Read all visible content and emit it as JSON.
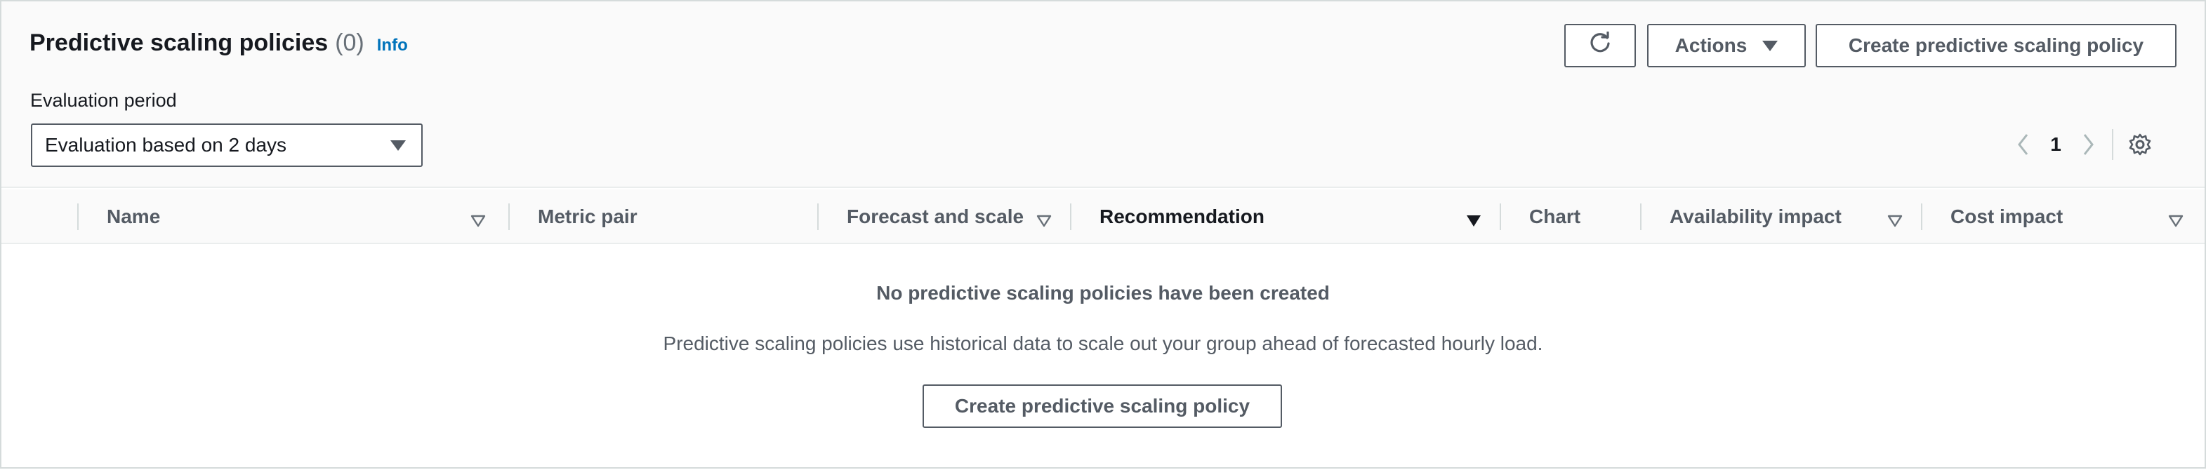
{
  "header": {
    "title": "Predictive scaling policies",
    "count": "(0)",
    "info_link": "Info",
    "refresh_icon": "refresh-icon",
    "actions_label": "Actions",
    "create_label": "Create predictive scaling policy"
  },
  "evaluation": {
    "label": "Evaluation period",
    "selected": "Evaluation based on 2 days"
  },
  "pagination": {
    "current_page": "1",
    "prev_icon": "chevron-left-icon",
    "next_icon": "chevron-right-icon",
    "settings_icon": "gear-icon"
  },
  "table": {
    "columns": [
      {
        "label": "Name",
        "sortable": true
      },
      {
        "label": "Metric pair",
        "sortable": false
      },
      {
        "label": "Forecast and scale",
        "sortable": true
      },
      {
        "label": "Recommendation",
        "sortable": true,
        "active_sort": true
      },
      {
        "label": "Chart",
        "sortable": false
      },
      {
        "label": "Availability impact",
        "sortable": true
      },
      {
        "label": "Cost impact",
        "sortable": true
      }
    ]
  },
  "empty_state": {
    "title": "No predictive scaling policies have been created",
    "description": "Predictive scaling policies use historical data to scale out your group ahead of forecasted hourly load.",
    "button_label": "Create predictive scaling policy"
  },
  "colors": {
    "text": "#16191f",
    "secondary_text": "#545b64",
    "link": "#0073bb",
    "border": "#545b64"
  }
}
